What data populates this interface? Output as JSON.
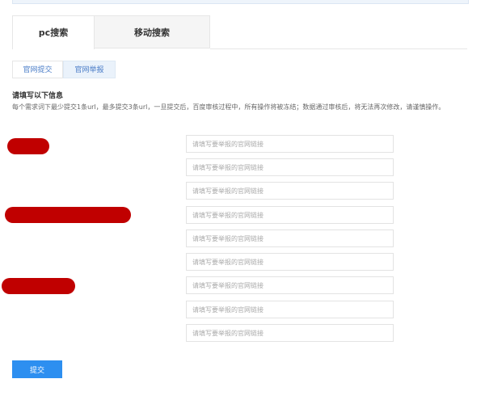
{
  "tabs": [
    {
      "label": "pc搜索"
    },
    {
      "label": "移动搜索"
    }
  ],
  "subtabs": [
    {
      "label": "官网提交"
    },
    {
      "label": "官网举报"
    }
  ],
  "form": {
    "heading": "请填写以下信息",
    "description": "每个需求词下最少提交1条url，最多提交3条url，一旦提交后，百度审核过程中，所有操作将被冻结；数据通过审核后，将无法再次修改，请谨慎操作。",
    "placeholder": "请填写要举报的官网链接",
    "submit_label": "提交"
  },
  "colors": {
    "accent": "#2d8ff0",
    "redaction": "#c00000"
  }
}
